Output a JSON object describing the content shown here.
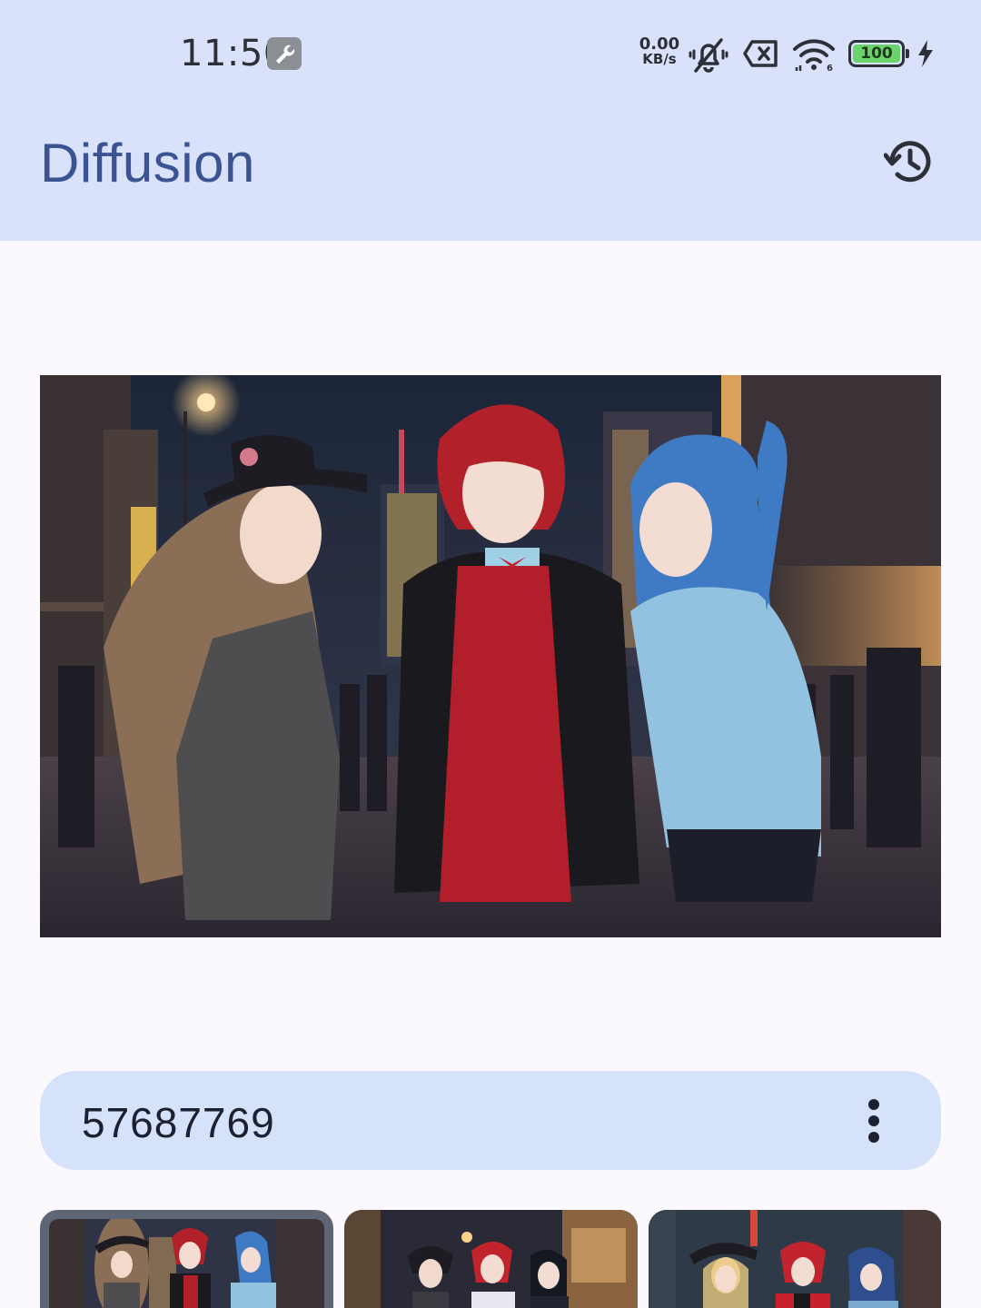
{
  "status_bar": {
    "time": "11:50",
    "net_speed_value": "0.00",
    "net_speed_unit": "KB/s",
    "battery": "100",
    "icons": [
      "wrench-icon",
      "vibrate-off-icon",
      "sim-off-icon",
      "wifi-icon",
      "battery-icon",
      "charging-icon"
    ]
  },
  "app_bar": {
    "title": "Diffusion",
    "action_icon": "history-icon"
  },
  "main_image": {
    "description_icon": "generated-image"
  },
  "seed_field": {
    "value": "57687769",
    "menu_icon": "more-vert-icon"
  },
  "thumbnails": {
    "count": 3,
    "selected_index": 0
  },
  "colors": {
    "app_bar_bg": "#D9E2FA",
    "title": "#3A5392",
    "seed_bg": "#D6E1FA",
    "page_bg": "#FBF8FE"
  }
}
